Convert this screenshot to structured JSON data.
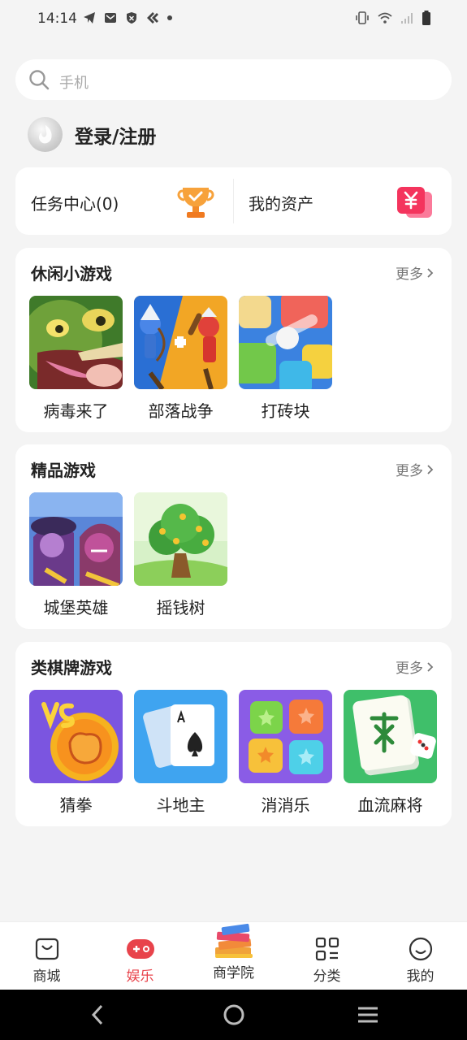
{
  "status_bar": {
    "time": "14:14"
  },
  "search": {
    "placeholder": "手机"
  },
  "login": {
    "label": "登录/注册"
  },
  "assets": {
    "tasks_label": "任务中心(0)",
    "assets_label": "我的资产"
  },
  "sections": [
    {
      "title": "休闲小游戏",
      "more_label": "更多",
      "games": [
        {
          "name": "病毒来了",
          "icon": "virus-game-icon"
        },
        {
          "name": "部落战争",
          "icon": "tribe-war-game-icon"
        },
        {
          "name": "打砖块",
          "icon": "brick-breaker-game-icon"
        }
      ]
    },
    {
      "title": "精品游戏",
      "more_label": "更多",
      "games": [
        {
          "name": "城堡英雄",
          "icon": "castle-hero-game-icon"
        },
        {
          "name": "摇钱树",
          "icon": "money-tree-game-icon"
        }
      ]
    },
    {
      "title": "类棋牌游戏",
      "more_label": "更多",
      "games": [
        {
          "name": "猜拳",
          "icon": "rock-paper-scissors-game-icon"
        },
        {
          "name": "斗地主",
          "icon": "poker-game-icon"
        },
        {
          "name": "消消乐",
          "icon": "match-three-game-icon"
        },
        {
          "name": "血流麻将",
          "icon": "mahjong-game-icon"
        }
      ]
    }
  ],
  "tabbar": {
    "items": [
      {
        "label": "商城",
        "icon": "shopping-bag-icon",
        "active": false
      },
      {
        "label": "娱乐",
        "icon": "gamepad-icon",
        "active": true
      },
      {
        "label": "商学院",
        "icon": "books-icon",
        "active": false
      },
      {
        "label": "分类",
        "icon": "grid-icon",
        "active": false
      },
      {
        "label": "我的",
        "icon": "smiley-icon",
        "active": false
      }
    ]
  },
  "colors": {
    "accent": "#e8434b",
    "background": "#f4f4f4",
    "card": "#ffffff"
  }
}
